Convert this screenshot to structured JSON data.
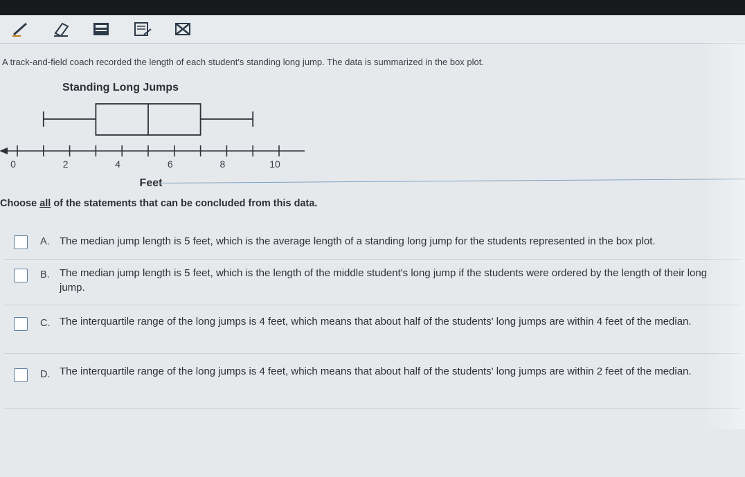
{
  "toolbar": {
    "tools": [
      "pencil-icon",
      "eraser-icon",
      "calculator-icon",
      "notepad-icon",
      "crossout-icon"
    ]
  },
  "prompt": "A track-and-field coach recorded the length of each student's standing long jump. The data is summarized in the box plot.",
  "chart_data": {
    "type": "boxplot",
    "title": "Standing Long Jumps",
    "xlabel": "Feet",
    "xlim": [
      0,
      11
    ],
    "tick_values": [
      0,
      1,
      2,
      3,
      4,
      5,
      6,
      7,
      8,
      9,
      10
    ],
    "tick_labels": [
      "0",
      "",
      "2",
      "",
      "4",
      "",
      "6",
      "",
      "8",
      "",
      "10"
    ],
    "min": 1,
    "q1": 3,
    "median": 5,
    "q3": 7,
    "max": 9
  },
  "question": {
    "before": "Choose ",
    "emphasis": "all",
    "after": " of the statements that can be concluded from this data."
  },
  "options": [
    {
      "letter": "A.",
      "text": "The median jump length is 5 feet, which is the average length of a standing long jump for the students represented in the box plot."
    },
    {
      "letter": "B.",
      "text": "The median jump length is 5 feet, which is the length of the middle student's long jump if the students were ordered by the length of their long jump."
    },
    {
      "letter": "C.",
      "text": "The interquartile range of the long jumps is 4 feet, which means that about half of the students' long jumps are within 4 feet of the median."
    },
    {
      "letter": "D.",
      "text": "The interquartile range of the long jumps is 4 feet, which means that about half of the students' long jumps are within 2 feet of the median."
    }
  ]
}
